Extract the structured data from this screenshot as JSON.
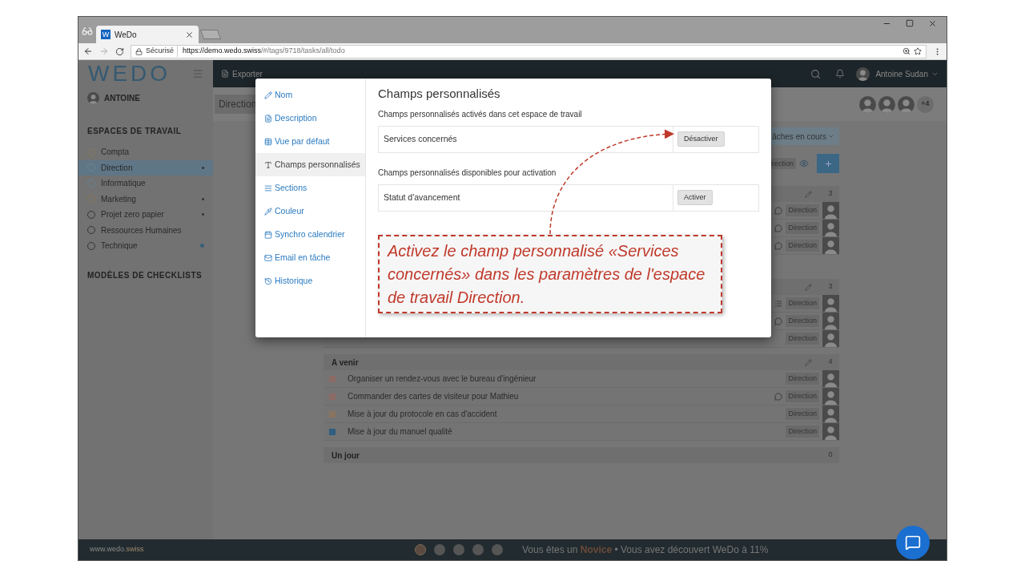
{
  "browser": {
    "tab_title": "WeDo",
    "tab_logo": "W",
    "secure_label": "Sécurisé",
    "url_host": "https://demo.wedo.swiss",
    "url_path": "/#/tags/9718/tasks/all/todo"
  },
  "sidebar": {
    "logo": "WEDO",
    "user": "ANTOINE",
    "workspaces_heading": "ESPACES DE TRAVAIL",
    "workspaces": [
      {
        "label": "Compta",
        "selected": false,
        "color": "#8a7858",
        "kind": "plain"
      },
      {
        "label": "Direction",
        "selected": true,
        "color": "#6c8494",
        "kind": "dot"
      },
      {
        "label": "Informatique",
        "selected": false,
        "color": "#64849c",
        "kind": "plain"
      },
      {
        "label": "Marketing",
        "selected": false,
        "color": "#8a7458",
        "kind": "dot"
      },
      {
        "label": "Projet zero papier",
        "selected": false,
        "color": "#333333",
        "kind": "dot"
      },
      {
        "label": "Ressources Humaines",
        "selected": false,
        "color": "#333333",
        "kind": "plain"
      },
      {
        "label": "Technique",
        "selected": false,
        "color": "#333333",
        "kind": "accent"
      }
    ],
    "checklists_heading": "MODÈLES DE CHECKLISTS"
  },
  "topbar": {
    "export": "Exporter",
    "user_name": "Antoine Sudan"
  },
  "toolbar": {
    "title": "Direction",
    "members_more": "+4",
    "filter": "âches en cours",
    "tag_filter": "irection"
  },
  "groups": [
    {
      "count": "3",
      "tasks": [
        {
          "kind": "comment",
          "tag": "Direction"
        },
        {
          "kind": "comment",
          "tag": "Direction"
        },
        {
          "kind": "comment",
          "tag": "Direction"
        }
      ]
    },
    {
      "count": "3",
      "tasks": [
        {
          "kind": "list",
          "tag": "Direction"
        },
        {
          "kind": "comment",
          "tag": "Direction"
        },
        {
          "kind": "plain",
          "tag": "Direction"
        }
      ]
    },
    {
      "title": "A venir",
      "count": "4",
      "tasks": [
        {
          "title": "Organiser un rendez-vous avec le bureau d'ingénieur",
          "color": "#8b6a64",
          "kind": "plain",
          "tag": "Direction"
        },
        {
          "title": "Commander des cartes de visiteur pour Mathieu",
          "color": "#8b6a64",
          "kind": "comment",
          "tag": "Direction"
        },
        {
          "title": "Mise à jour du protocole en cas d'accident",
          "color": "#8a7460",
          "kind": "plain",
          "tag": "Direction"
        },
        {
          "title": "Mise à jour du manuel qualité",
          "color": "#2f5f80",
          "kind": "plain",
          "tag": "Direction"
        }
      ]
    },
    {
      "title": "Un jour",
      "count": "0"
    }
  ],
  "modal": {
    "nav": [
      {
        "label": "Nom",
        "kind": "pencil",
        "selected": false
      },
      {
        "label": "Description",
        "kind": "document",
        "selected": false
      },
      {
        "label": "Vue par défaut",
        "kind": "table",
        "selected": false
      },
      {
        "label": "Champs personnalisés",
        "kind": "text",
        "selected": true
      },
      {
        "label": "Sections",
        "kind": "lines",
        "selected": false
      },
      {
        "label": "Couleur",
        "kind": "pipette",
        "selected": false
      },
      {
        "label": "Synchro calendrier",
        "kind": "calendar",
        "selected": false
      },
      {
        "label": "Email en tâche",
        "kind": "envelope",
        "selected": false
      },
      {
        "label": "Historique",
        "kind": "history",
        "selected": false
      }
    ],
    "title": "Champs personnalisés",
    "active_heading": "Champs personnalisés activés dans cet espace de travail",
    "active_fields": [
      {
        "name": "Services concernés",
        "action": "Désactiver"
      }
    ],
    "available_heading": "Champs personnalisés disponibles pour activation",
    "available_fields": [
      {
        "name": "Statut d'avancement",
        "action": "Activer"
      }
    ],
    "callout": "Activez le champ personnalisé «Services concernés» dans les paramètres de l'espace de travail Direction."
  },
  "footer": {
    "site": "www.wedo",
    "site_suffix": ".swiss",
    "steps": [
      {
        "active": true
      },
      {
        "active": false
      },
      {
        "active": false
      },
      {
        "active": false
      },
      {
        "active": false
      }
    ],
    "progress_prefix": "Vous êtes un",
    "level": "Novice",
    "progress_suffix": "• Vous avez découvert WeDo à 11%"
  }
}
